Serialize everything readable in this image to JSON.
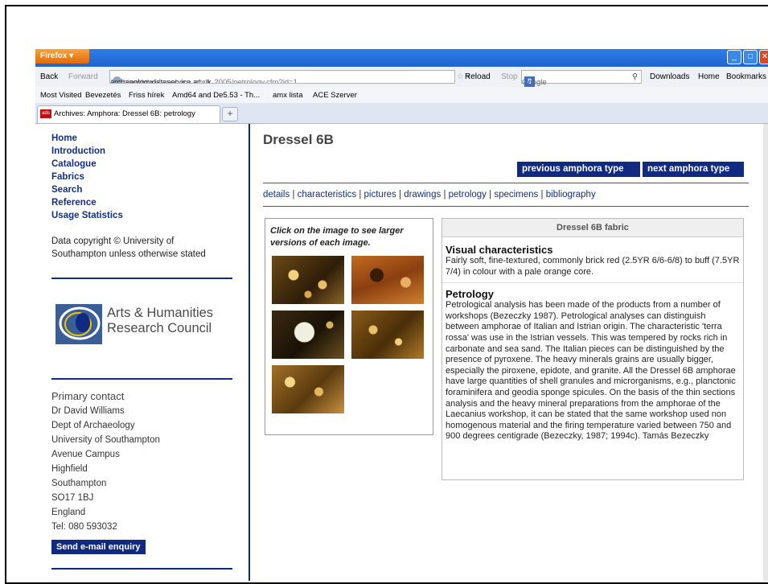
{
  "browser": {
    "firefox_menu": "Firefox ▾",
    "nav": {
      "back": "Back",
      "forward": "Forward",
      "url_host": "archaeologydataservice.ac.uk",
      "url_path": "/archives/view/amphora_ahrb_2005/petrology.cfm?id=1",
      "reload": "Reload",
      "stop": "Stop",
      "search_placeholder": "Google",
      "downloads": "Downloads",
      "home": "Home",
      "bookmarks": "Bookmarks"
    },
    "bookmarks_bar": [
      "Most Visited",
      "Bevezetés",
      "Friss hírek",
      "Amd64 and De5.53 - Th...",
      "amx lista",
      "ACE Szerver"
    ],
    "tab_title": "Archives: Amphora: Dressel 6B: petrology",
    "favicon_text": "ads",
    "new_tab": "+"
  },
  "sidebar": {
    "nav_links": [
      "Home",
      "Introduction",
      "Catalogue",
      "Fabrics",
      "Search",
      "Reference",
      "Usage Statistics"
    ],
    "copyright_line1": "Data copyright © University of",
    "copyright_line2": "Southampton unless otherwise stated",
    "logo_line1": "Arts & Humanities",
    "logo_line2": "Research Council",
    "contact_heading": "Primary contact",
    "contact_lines": [
      "Dr David Williams",
      "Dept of Archaeology",
      "University of Southampton",
      "Avenue Campus",
      "Highfield",
      "Southampton",
      "SO17 1BJ",
      "England",
      "Tel: 080 593032"
    ],
    "email_button": "Send e-mail enquiry"
  },
  "main": {
    "title": "Dressel 6B",
    "prev_button": "previous amphora type",
    "next_button": "next amphora type",
    "tabs": [
      "details",
      "characteristics",
      "pictures",
      "drawings",
      "petrology",
      "specimens",
      "bibliography"
    ],
    "image_caption": "Click on the image to see larger versions of each image.",
    "fabric_header": "Dressel 6B fabric",
    "visual_heading": "Visual characteristics",
    "visual_text": "Fairly soft, fine-textured, commonly brick red (2.5YR 6/6-6/8) to buff (7.5YR 7/4) in colour with a pale orange core.",
    "petrology_heading": "Petrology",
    "petrology_text": "Petrological analysis has been made of the products from a number of workshops (Bezeczky 1987). Petrological analyses can distinguish between amphorae of Italian and Istrian origin. The characteristic 'terra rossa' was use in the Istrian vessels. This was tempered by rocks rich in carbonate and sea sand. The Italian pieces can be distinguished by the presence of pyroxene. The heavy minerals grains are usually bigger, especially the piroxene, epidote, and granite. All the Dressel 6B amphorae have large quantities of shell granules and microrganisms, e.g., planctonic foraminifera and geodia sponge spicules. On the basis of the thin sections analysis and the heavy mineral preparations from the amphorae of the Laecanius workshop, it can be stated that the same workshop used non homogenous material and the firing temperature varied between 750 and 900 degrees centigrade (Bezeczky, 1987; 1994c). Tamás Bezeczky"
  },
  "colors": {
    "accent_navy": "#0f2a80",
    "link_blue": "#10308a",
    "firefox_orange": "#e97a18"
  }
}
